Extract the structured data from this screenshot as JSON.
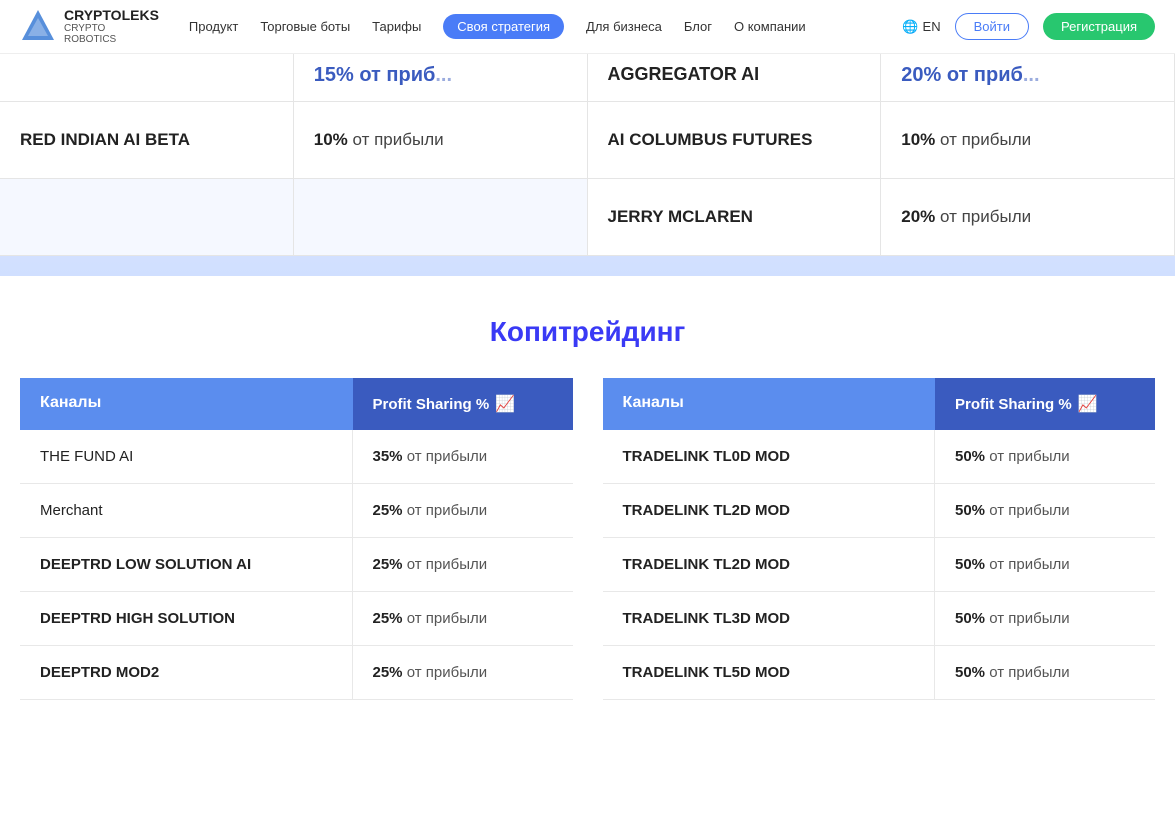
{
  "header": {
    "logo_main": "CRYPTOLEKS",
    "logo_sub": "CRYPTO\nROBOTICS",
    "nav": [
      {
        "label": "Продукт",
        "active": false
      },
      {
        "label": "Торговые боты",
        "active": false
      },
      {
        "label": "Тарифы",
        "active": false
      },
      {
        "label": "Своя стратегия",
        "active": true
      },
      {
        "label": "Для бизнеса",
        "active": false
      },
      {
        "label": "Блог",
        "active": false
      },
      {
        "label": "О компании",
        "active": false
      }
    ],
    "lang": "🌐 EN",
    "login": "Войти",
    "register": "Регистрация"
  },
  "top_section": {
    "partial_cards": [
      {
        "text": "15% от приб...",
        "col": 2
      },
      {
        "text": "20% от приб...",
        "col": 4
      }
    ],
    "aggregator_title": "AGGREGATOR AI",
    "cards": [
      {
        "name": "RED INDIAN AI BETA",
        "profit_pct": "10%",
        "profit_label": "от прибыли"
      },
      {
        "name": "AI COLUMBUS FUTURES",
        "profit_pct": "10%",
        "profit_label": "от прибыли"
      },
      {
        "name": "JERRY MCLAREN",
        "profit_pct": "20%",
        "profit_label": "от прибыли"
      }
    ]
  },
  "copy_trading": {
    "title": "Копитрейдинг",
    "table_left": {
      "header_channel": "Каналы",
      "header_profit": "Profit Sharing %",
      "rows": [
        {
          "channel": "THE FUND AI",
          "bold": false,
          "profit_pct": "35%",
          "profit_label": "от прибыли"
        },
        {
          "channel": "Merchant",
          "bold": false,
          "profit_pct": "25%",
          "profit_label": "от прибыли"
        },
        {
          "channel": "DEEPTRD LOW SOLUTION AI",
          "bold": true,
          "profit_pct": "25%",
          "profit_label": "от прибыли"
        },
        {
          "channel": "DEEPTRD HIGH SOLUTION",
          "bold": true,
          "profit_pct": "25%",
          "profit_label": "от прибыли"
        },
        {
          "channel": "DEEPTRD MOD2",
          "bold": true,
          "profit_pct": "25%",
          "profit_label": "от прибыли"
        }
      ]
    },
    "table_right": {
      "header_channel": "Каналы",
      "header_profit": "Profit Sharing %",
      "rows": [
        {
          "channel": "TRADELINK TL0D MOD",
          "bold": true,
          "profit_pct": "50%",
          "profit_label": "от прибыли"
        },
        {
          "channel": "TRADELINK TL2D MOD",
          "bold": true,
          "profit_pct": "50%",
          "profit_label": "от прибыли"
        },
        {
          "channel": "TRADELINK TL2D MOD",
          "bold": true,
          "profit_pct": "50%",
          "profit_label": "от прибыли"
        },
        {
          "channel": "TRADELINK TL3D MOD",
          "bold": true,
          "profit_pct": "50%",
          "profit_label": "от прибыли"
        },
        {
          "channel": "TRADELINK TL5D MOD",
          "bold": true,
          "profit_pct": "50%",
          "profit_label": "от прибыли"
        }
      ]
    }
  }
}
